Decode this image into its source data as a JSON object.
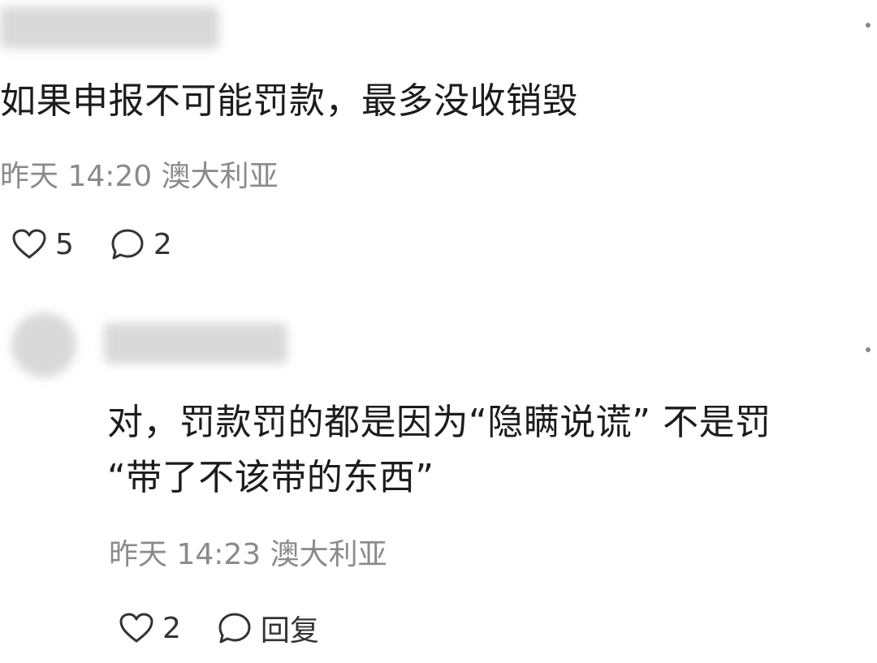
{
  "comments": [
    {
      "text": "如果申报不可能罚款，最多没收销毁",
      "time": "昨天 14:20",
      "location": "澳大利亚",
      "likes": "5",
      "replies": "2"
    },
    {
      "text_line1": "对，罚款罚的都是因为“隐瞒说谎” 不是罚",
      "text_line2": "“带了不该带的东西”",
      "time": "昨天 14:23",
      "location": "澳大利亚",
      "likes": "2",
      "reply_label": "回复"
    }
  ],
  "icons": {
    "like": "heart-outline-icon",
    "comment": "speech-bubble-icon",
    "more": "more-dot-icon"
  }
}
